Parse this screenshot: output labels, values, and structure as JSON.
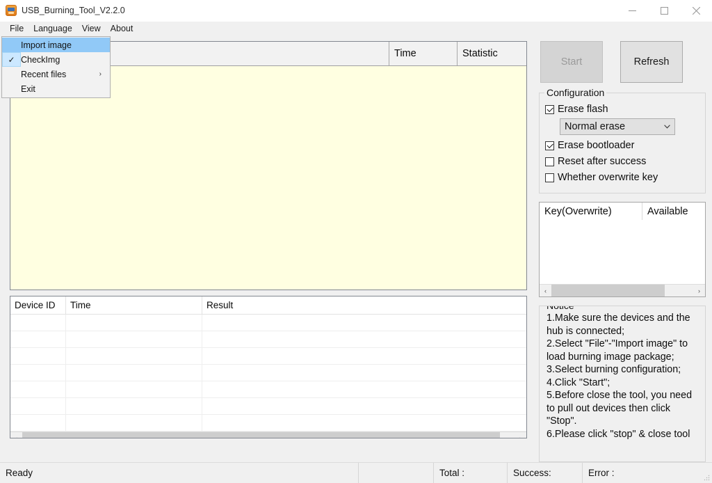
{
  "window": {
    "title": "USB_Burning_Tool_V2.2.0",
    "icon": "usb-burning-tool-icon",
    "minimize_label": "minimize-icon",
    "maximize_label": "maximize-icon",
    "close_label": "close-icon"
  },
  "menubar": {
    "items": [
      {
        "label": "File"
      },
      {
        "label": "Language"
      },
      {
        "label": "View"
      },
      {
        "label": "About"
      }
    ]
  },
  "file_menu": {
    "open": true,
    "items": [
      {
        "label": "Import image",
        "highlighted": true,
        "checked": false,
        "submenu": false
      },
      {
        "label": "CheckImg",
        "highlighted": false,
        "checked": true,
        "submenu": false
      },
      {
        "label": "Recent files",
        "highlighted": false,
        "checked": false,
        "submenu": true,
        "arrow": "›"
      },
      {
        "label": "Exit",
        "highlighted": false,
        "checked": false,
        "submenu": false
      }
    ]
  },
  "device_grid": {
    "columns": [
      "",
      "Time",
      "Statistic"
    ],
    "rows": []
  },
  "log_grid": {
    "columns": [
      "Device ID",
      "Time",
      "Result"
    ],
    "rows": [],
    "scrollbar": {
      "left_arrow": "‹",
      "right_arrow": "›",
      "thumb_percent": 97
    }
  },
  "actions": {
    "start_label": "Start",
    "start_disabled": true,
    "refresh_label": "Refresh"
  },
  "configuration": {
    "title": "Configuration",
    "options": [
      {
        "label": "Erase flash",
        "checked": true
      },
      {
        "label": "Erase bootloader",
        "checked": true
      },
      {
        "label": "Reset after success",
        "checked": false
      },
      {
        "label": "Whether overwrite key",
        "checked": false
      }
    ],
    "erase_mode": {
      "selected": "Normal erase",
      "arrow": "˅"
    }
  },
  "key_panel": {
    "columns": [
      "Key(Overwrite)",
      "Available"
    ],
    "rows": [],
    "scrollbar": {
      "left_arrow": "‹",
      "right_arrow": "›",
      "thumb_percent": 80
    }
  },
  "notice": {
    "title": "Notice",
    "text": "1.Make sure the devices and the hub is connected;\n2.Select \"File\"-\"Import image\" to load burning image package;\n3.Select burning configuration;\n4.Click \"Start\";\n5.Before close the tool, you need to pull out devices then click \"Stop\".\n6.Please click \"stop\" & close tool"
  },
  "statusbar": {
    "status": "Ready",
    "blank": "",
    "total_label": "Total :",
    "success_label": "Success:",
    "error_label": "Error :"
  },
  "colors": {
    "window_bg": "#f0f0f0",
    "grid_yellow": "#ffffe1",
    "menu_highlight": "#91c9f7",
    "menu_check_gutter": "#cce8ff"
  }
}
